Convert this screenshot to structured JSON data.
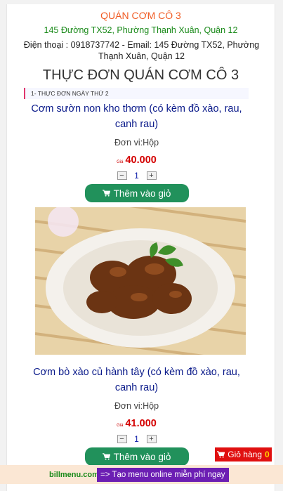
{
  "header": {
    "shop_name": "QUÁN CƠM CÔ 3",
    "address": "145 Đường TX52, Phường Thạnh Xuân, Quận 12",
    "contact": "Điện thoại : 0918737742 - Email: 145 Đường TX52, Phường Thạnh Xuân, Quận 12",
    "menu_title": "THỰC ĐƠN QUÁN CƠM CÔ 3"
  },
  "section": {
    "label": "1- THỰC ĐƠN NGÀY THỨ 2"
  },
  "products": [
    {
      "name": "Cơm sườn non kho thơm (có kèm đồ xào, rau, canh rau)",
      "unit": "Đơn vi:Hộp",
      "price_label": "Giá",
      "price": "40.000",
      "quantity": "1",
      "add_label": "Thêm vào giỏ"
    },
    {
      "name": "Cơm bò xào củ hành tây (có kèm đồ xào, rau, canh rau)",
      "unit": "Đơn vi:Hộp",
      "price_label": "Giá",
      "price": "41.000",
      "quantity": "1",
      "add_label": "Thêm vào giỏ"
    }
  ],
  "qty_controls": {
    "minus": "−",
    "plus": "+"
  },
  "cart": {
    "label": "Giỏ hàng",
    "count": "0"
  },
  "footer": {
    "brand": "billmenu.com",
    "promo": "=> Tạo menu online miễn phí ngay"
  },
  "colors": {
    "accent_orange": "#f05a22",
    "address_green": "#1a8a1a",
    "product_title": "#0a1a8a",
    "price_red": "#d40000",
    "button_green": "#21915b",
    "cart_red": "#e01010",
    "promo_purple": "#6c1eb3"
  }
}
